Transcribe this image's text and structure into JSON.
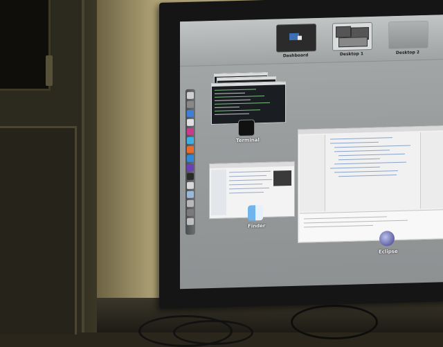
{
  "mission_control": {
    "spaces": [
      {
        "label": "Dashboard"
      },
      {
        "label": "Desktop 1"
      },
      {
        "label": "Desktop 2"
      }
    ],
    "groups": [
      {
        "label": "Terminal",
        "icon": "terminal-icon"
      },
      {
        "label": "Finder",
        "icon": "finder-icon"
      },
      {
        "label": "Eclipse",
        "icon": "eclipse-icon"
      }
    ]
  },
  "colors": {
    "screen_background": "#9a9e9f",
    "terminal_background": "#1a1d22",
    "label_text": "#f4f4f4"
  }
}
